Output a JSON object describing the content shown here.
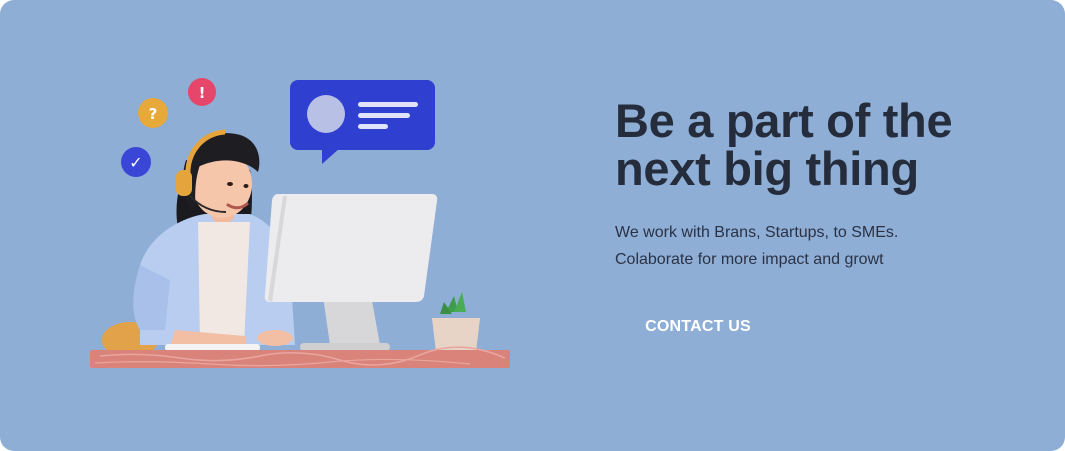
{
  "hero": {
    "headline": "Be a part of the next big thing",
    "subtext_line1": "We work with Brans, Startups, to SMEs.",
    "subtext_line2": "Colaborate for more impact and growt",
    "cta_label": "CONTACT US"
  },
  "illustration": {
    "icons": [
      "check-icon",
      "question-icon",
      "exclamation-icon",
      "chat-bubble-icon"
    ],
    "badge_check": "✓",
    "badge_question": "?",
    "badge_alert": "!"
  },
  "colors": {
    "background": "#8eaed6",
    "heading": "#252d3d",
    "body_text": "#2b3245",
    "cta_text": "#ffffff",
    "chat_bubble": "#2f3fcf",
    "desk": "#d9837a"
  }
}
